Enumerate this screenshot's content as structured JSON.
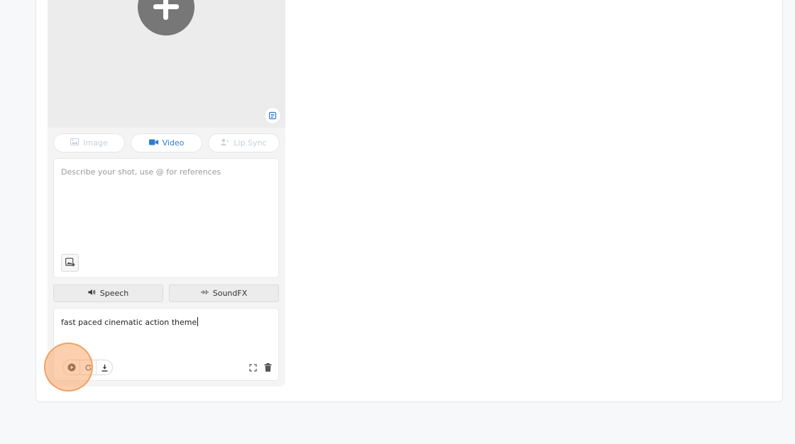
{
  "tabs": {
    "image_label": "Image",
    "video_label": "Video",
    "lipsync_label": "Lip Sync"
  },
  "prompt": {
    "placeholder": "Describe your shot, use @ for references"
  },
  "audio_tabs": {
    "speech_label": "Speech",
    "soundfx_label": "SoundFX"
  },
  "music": {
    "text": "fast paced cinematic action theme"
  },
  "colors": {
    "accent": "#2d7dd2",
    "disabled": "#c4cfdc",
    "highlight": "#f5a66a"
  },
  "icons": [
    "plus-icon",
    "notes-icon",
    "image-icon",
    "video-camera-icon",
    "lip-sync-icon",
    "add-image-icon",
    "speaker-icon",
    "waveform-icon",
    "play-icon",
    "refresh-icon",
    "download-icon",
    "fullscreen-icon",
    "trash-icon"
  ]
}
